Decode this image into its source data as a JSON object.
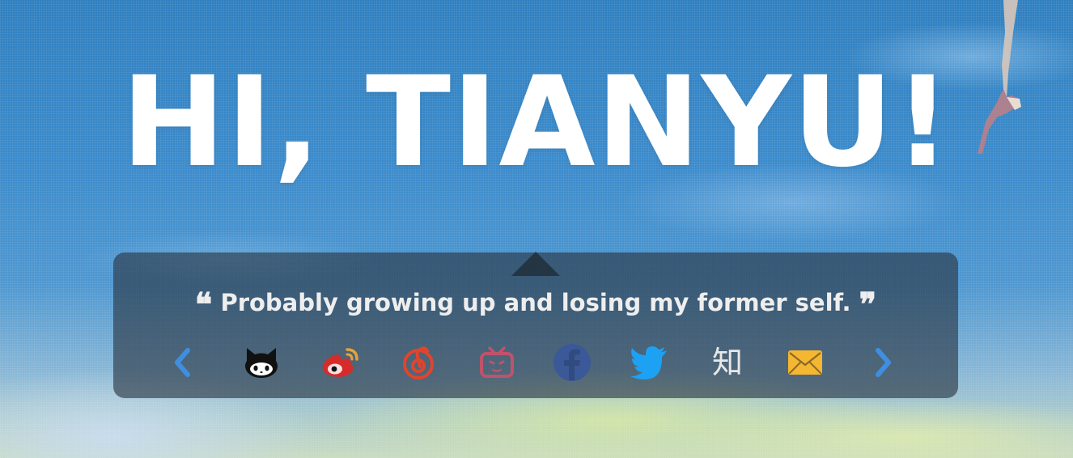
{
  "hero": {
    "greeting": "HI, TIANYU!"
  },
  "quote": {
    "open_mark": "❝",
    "text": "Probably growing up and losing my former self.",
    "close_mark": "❞"
  },
  "social": {
    "prev_icon": "chevron-left-icon",
    "next_icon": "chevron-right-icon",
    "items": [
      {
        "icon": "github-icon",
        "color": "#111111"
      },
      {
        "icon": "weibo-icon",
        "color": "#d52c2b"
      },
      {
        "icon": "netease-music-icon",
        "color": "#e0452c"
      },
      {
        "icon": "bilibili-icon",
        "color": "#c0526b"
      },
      {
        "icon": "facebook-icon",
        "color": "#3b5998"
      },
      {
        "icon": "twitter-icon",
        "color": "#1da1f2"
      },
      {
        "icon": "zhihu-icon",
        "label": "知",
        "color": "#e8e8e8"
      },
      {
        "icon": "email-icon",
        "color": "#f5b731"
      }
    ],
    "arrow_color": "#3f8fe0"
  }
}
